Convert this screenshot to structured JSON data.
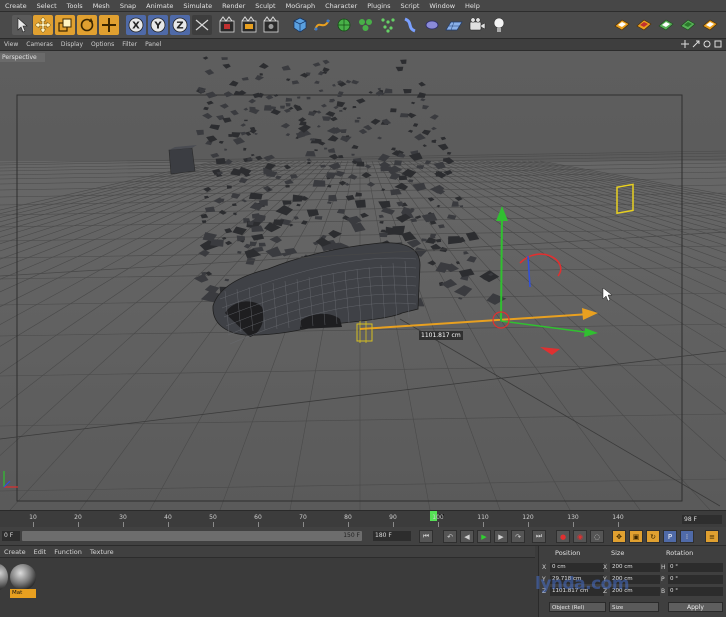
{
  "menubar": {
    "items": [
      "Create",
      "Select",
      "Tools",
      "Mesh",
      "Snap",
      "Animate",
      "Simulate",
      "Render",
      "Sculpt",
      "MoGraph",
      "Character",
      "Plugins",
      "Script",
      "Window",
      "Help"
    ]
  },
  "toolbar": {
    "icons": [
      "live-selection-icon",
      "move-icon",
      "scale-icon",
      "rotate-icon",
      "add-icon",
      "x-axis-icon",
      "y-axis-icon",
      "z-axis-icon",
      "world-coordinates-icon",
      "render-view-icon",
      "render-picture-viewer-icon",
      "edit-render-settings-icon",
      "cube-icon",
      "spline-icon",
      "nurbs-icon",
      "array-icon",
      "particle-icon",
      "deformer-icon",
      "floor-icon",
      "camera-icon",
      "light-icon"
    ],
    "axis_labels": [
      "X",
      "Y",
      "Z"
    ]
  },
  "viewport_menu": {
    "items": [
      "View",
      "Cameras",
      "Display",
      "Options",
      "Filter",
      "Panel"
    ]
  },
  "viewport": {
    "camera_label": "Perspective",
    "dimension_readout": "1101.817 cm"
  },
  "timeline": {
    "ticks": [
      "0",
      "10",
      "20",
      "30",
      "40",
      "50",
      "60",
      "70",
      "80",
      "90",
      "100",
      "110",
      "120",
      "130",
      "140",
      "150"
    ],
    "current_frame": "98",
    "end_frame_field": "98 F"
  },
  "rangebar": {
    "start_field": "0 F",
    "range_end": "150 F",
    "end_field": "180 F"
  },
  "material_manager": {
    "menu": [
      "Create",
      "Edit",
      "Function",
      "Texture"
    ],
    "material_name": "Mat"
  },
  "coordinates": {
    "headers": [
      "Position",
      "Size",
      "Rotation"
    ],
    "rows": [
      {
        "axis": "X",
        "position": "0 cm",
        "size_axis": "X",
        "size": "200 cm",
        "rot_axis": "H",
        "rotation": "0 °"
      },
      {
        "axis": "Y",
        "position": "29.718 cm",
        "size_axis": "Y",
        "size": "200 cm",
        "rot_axis": "P",
        "rotation": "0 °"
      },
      {
        "axis": "Z",
        "position": "1101.817 cm",
        "size_axis": "Z",
        "size": "200 cm",
        "rot_axis": "B",
        "rotation": "0 °"
      }
    ],
    "mode_dropdown": "Object (Rel)",
    "size_dropdown": "Size",
    "apply_label": "Apply"
  },
  "watermark": "lynda.com",
  "colors": {
    "accent_orange": "#e8a020",
    "axis_x": "#e03030",
    "axis_y": "#30c030",
    "axis_z": "#3050e0",
    "playhead": "#55e055"
  }
}
